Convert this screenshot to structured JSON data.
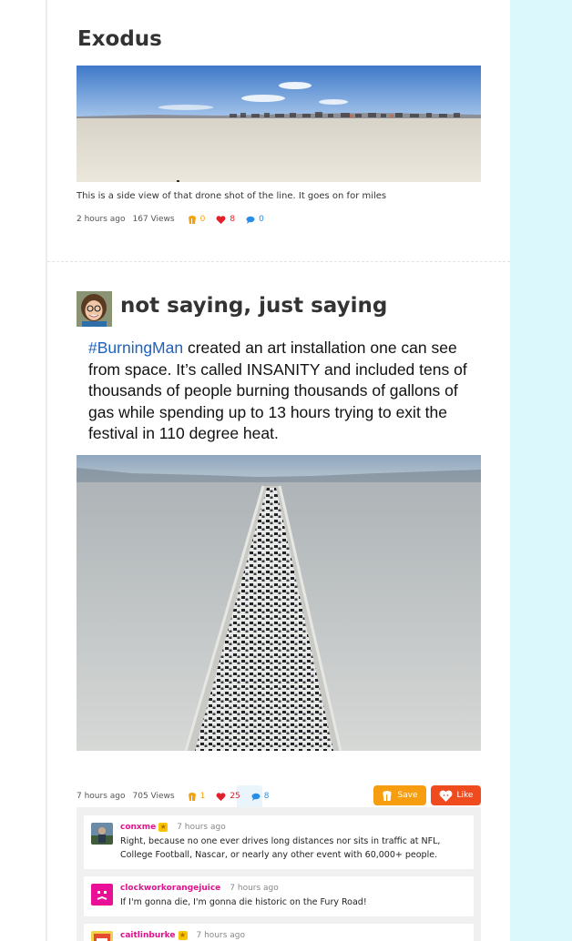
{
  "colors": {
    "right_panel": "#dbf8fd",
    "hashtag": "#1d62c0",
    "views_icon": "#f4a20c",
    "likes_icon": "#e0202a",
    "comments_icon": "#2a8de6",
    "save_button": "#f69d10",
    "like_button": "#f04b1f",
    "username": "#e0128e"
  },
  "posts": [
    {
      "title": "Exodus",
      "image_alt": "panoramic desert with line of vehicles",
      "caption": "This is a side view of that drone shot of the line. It goes on for miles",
      "meta": {
        "time": "2 hours ago",
        "views": "167 Views",
        "saves": "0",
        "likes": "8",
        "comments": "0"
      }
    },
    {
      "title": "not saying, just saying",
      "tweet_hashtag": "#BurningMan",
      "tweet_text": " created an art installation one can see from space. It’s called INSANITY and included tens of thousands of people burning thousands of gallons of gas while spending up to 13 hours trying to exit the festival in 110 degree heat.",
      "image_alt": "aerial view of long line of cars on desert road",
      "meta": {
        "time": "7 hours ago",
        "views": "705 Views",
        "saves": "1",
        "likes": "25",
        "comments": "8"
      },
      "buttons": {
        "save_label": "Save",
        "like_label": "Like"
      },
      "comments": [
        {
          "user": "conxme",
          "badge": "★",
          "time": "7 hours ago",
          "text": "Right, because no one ever drives long distances nor sits in traffic at NFL, College Football, Nascar, or nearly any other event with 60,000+ people."
        },
        {
          "user": "clockworkorangejuice",
          "time": "7 hours ago",
          "text": "If I'm gonna die, I'm gonna die historic on the Fury Road!"
        },
        {
          "user": "caitlinburke",
          "badge": "★",
          "time": "7 hours ago",
          "text": ""
        }
      ]
    }
  ]
}
